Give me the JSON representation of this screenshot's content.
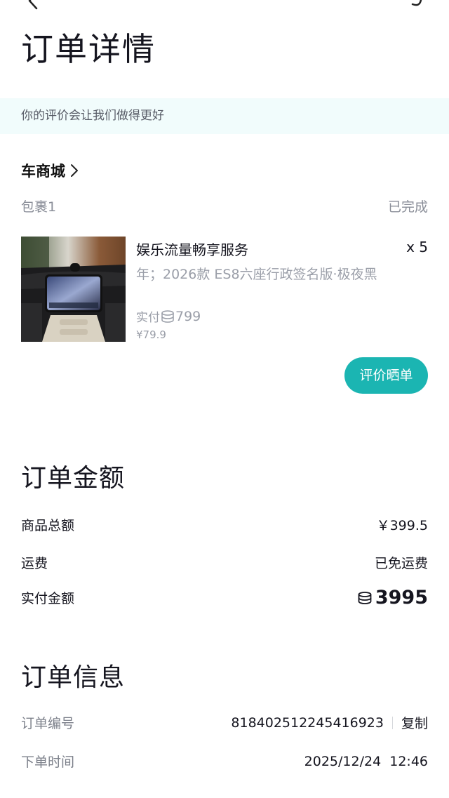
{
  "header": {
    "title": "订单详情"
  },
  "notice": {
    "text": "你的评价会让我们做得更好"
  },
  "store": {
    "name": "车商城"
  },
  "package": {
    "label": "包裹1",
    "status": "已完成"
  },
  "product": {
    "name": "娱乐流量畅享服务",
    "quantity": "x 5",
    "spec": "年；2026款 ES8六座行政签名版·极夜黑",
    "paid_label": "实付",
    "paid_points": "799",
    "price": "¥79.9",
    "review_button": "评价晒单"
  },
  "order_amount": {
    "title": "订单金额",
    "goods_total_label": "商品总额",
    "goods_total_value": "￥399.5",
    "shipping_label": "运费",
    "shipping_value": "已免运费",
    "paid_label": "实付金额",
    "paid_value": "3995"
  },
  "order_info": {
    "title": "订单信息",
    "order_no_label": "订单编号",
    "order_no_value": "818402512245416923",
    "copy_label": "复制",
    "order_time_label": "下单时间",
    "order_time_value": "2025/12/24  12:46"
  },
  "colors": {
    "accent": "#1bb5b2",
    "notice_bg": "#f1fcfc",
    "muted_text": "#8a8e98"
  },
  "icons": {
    "back": "chevron-left-icon",
    "share": "share-icon",
    "store_arrow": "chevron-right-icon",
    "points": "points-coin-icon"
  }
}
